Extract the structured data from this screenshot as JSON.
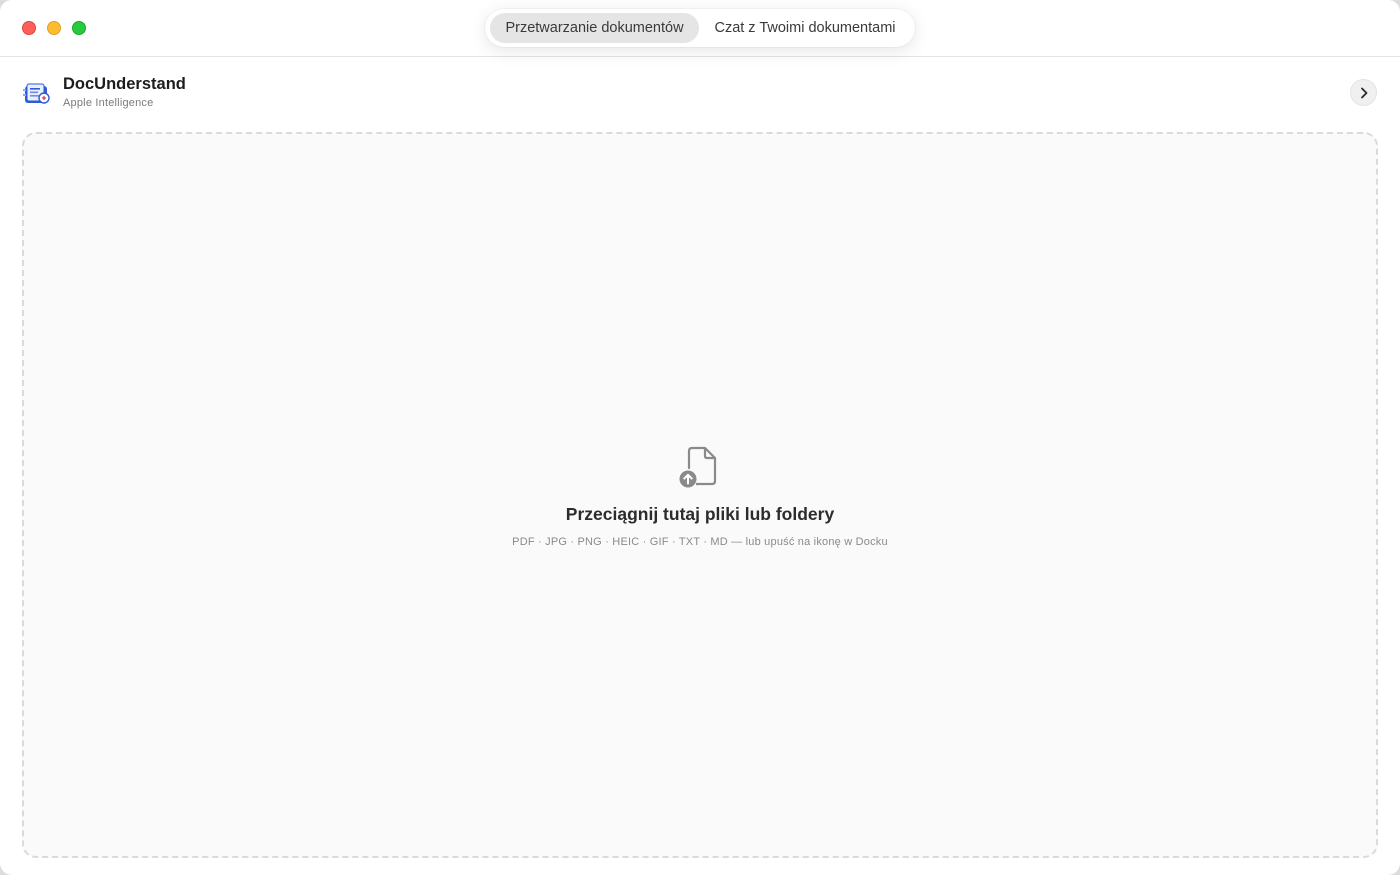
{
  "window": {
    "tabs": [
      {
        "label": "Przetwarzanie dokumentów",
        "active": true
      },
      {
        "label": "Czat z Twoimi dokumentami",
        "active": false
      }
    ]
  },
  "header": {
    "app_name": "DocUnderstand",
    "subtitle": "Apple Intelligence",
    "logo_icon": "docunderstand-logo-icon",
    "expand_icon": "chevron-right-icon"
  },
  "dropzone": {
    "icon": "document-upload-icon",
    "title": "Przeciągnij tutaj pliki lub foldery",
    "subtitle": "PDF · JPG · PNG · HEIC · GIF · TXT · MD — lub upuść na ikonę w Docku"
  },
  "colors": {
    "close": "#ff5f57",
    "minimize": "#febc2e",
    "maximize": "#28c840",
    "logo_accent": "#2f5bd3"
  }
}
